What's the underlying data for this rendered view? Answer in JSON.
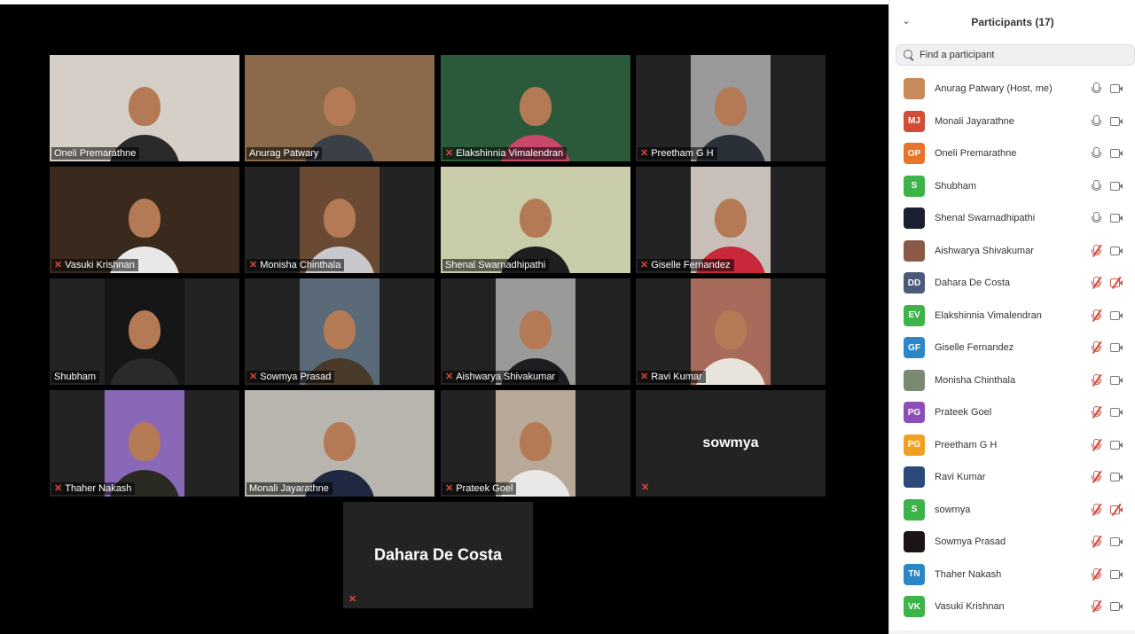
{
  "panel": {
    "title": "Participants (17)",
    "search_placeholder": "Find a participant",
    "participants": [
      {
        "name": "Anurag Patwary (Host, me)",
        "initials": "",
        "color": "#c98a5a",
        "mic": "on",
        "cam": "on"
      },
      {
        "name": "Monali Jayarathne",
        "initials": "MJ",
        "color": "#d24d36",
        "mic": "on",
        "cam": "on"
      },
      {
        "name": "Oneli Premarathne",
        "initials": "OP",
        "color": "#e8742a",
        "mic": "on",
        "cam": "on"
      },
      {
        "name": "Shubham",
        "initials": "S",
        "color": "#3db34a",
        "mic": "on",
        "cam": "on"
      },
      {
        "name": "Shenal Swarnadhipathi",
        "initials": "",
        "color": "#1b2030",
        "mic": "on",
        "cam": "on"
      },
      {
        "name": "Aishwarya Shivakumar",
        "initials": "",
        "color": "#8a5a46",
        "mic": "off",
        "cam": "on"
      },
      {
        "name": "Dahara De Costa",
        "initials": "DD",
        "color": "#4a5a78",
        "mic": "off",
        "cam": "off"
      },
      {
        "name": "Elakshinnia Vimalendran",
        "initials": "EV",
        "color": "#3db34a",
        "mic": "off",
        "cam": "on"
      },
      {
        "name": "Giselle Fernandez",
        "initials": "GF",
        "color": "#2b86c5",
        "mic": "off",
        "cam": "on"
      },
      {
        "name": "Monisha Chinthala",
        "initials": "",
        "color": "#7a8a70",
        "mic": "off",
        "cam": "on"
      },
      {
        "name": "Prateek Goel",
        "initials": "PG",
        "color": "#8b4fb6",
        "mic": "off",
        "cam": "on"
      },
      {
        "name": "Preetham G H",
        "initials": "PG",
        "color": "#f0a020",
        "mic": "off",
        "cam": "on"
      },
      {
        "name": "Ravi Kumar",
        "initials": "",
        "color": "#2a4a7a",
        "mic": "off",
        "cam": "on"
      },
      {
        "name": "sowmya",
        "initials": "S",
        "color": "#3db34a",
        "mic": "off",
        "cam": "off"
      },
      {
        "name": "Sowmya Prasad",
        "initials": "",
        "color": "#1c1414",
        "mic": "off",
        "cam": "on"
      },
      {
        "name": "Thaher Nakash",
        "initials": "TN",
        "color": "#2b86c5",
        "mic": "off",
        "cam": "on"
      },
      {
        "name": "Vasuki Krishnan",
        "initials": "VK",
        "color": "#3db34a",
        "mic": "off",
        "cam": "on"
      }
    ]
  },
  "gallery": {
    "tiles": [
      {
        "label": "Oneli Premarathne",
        "muted": false,
        "bg": "#d6cfc8",
        "shirt": "#2a2a2a"
      },
      {
        "label": "Anurag Patwary",
        "muted": false,
        "active": true,
        "bg": "#8a6a4a",
        "shirt": "#3a3f48"
      },
      {
        "label": "Elakshinnia Vimalendran",
        "muted": true,
        "bg": "#2a5a3a",
        "shirt": "#c8476a"
      },
      {
        "label": "Preetham G H",
        "muted": true,
        "bg": "#9a9a9a",
        "shirt": "#2a3038"
      },
      {
        "label": "Vasuki Krishnan",
        "muted": true,
        "bg": "#3a2a1e",
        "shirt": "#e8e8e8"
      },
      {
        "label": "Monisha Chinthala",
        "muted": true,
        "bg": "#6a4a32",
        "shirt": "#c8c8cc"
      },
      {
        "label": "Shenal Swarnadhipathi",
        "muted": false,
        "bg": "#c8cca8",
        "shirt": "#1e1e1e"
      },
      {
        "label": "Giselle Fernandez",
        "muted": true,
        "bg": "#c8c0b8",
        "shirt": "#c8283a"
      },
      {
        "label": "Shubham",
        "muted": false,
        "bg": "#161616",
        "shirt": "#2a2a2a"
      },
      {
        "label": "Sowmya Prasad",
        "muted": true,
        "bg": "#5a6a78",
        "shirt": "#4a3a2a"
      },
      {
        "label": "Aishwarya Shivakumar",
        "muted": true,
        "bg": "#9a9a98",
        "shirt": "#1e1e22"
      },
      {
        "label": "Ravi Kumar",
        "muted": true,
        "bg": "#a86a5a",
        "shirt": "#e8e4dc"
      },
      {
        "label": "Thaher Nakash",
        "muted": true,
        "bg": "#8a68b8",
        "shirt": "#2a2a22"
      },
      {
        "label": "Monali Jayarathne",
        "muted": false,
        "bg": "#b8b4ae",
        "shirt": "#1e2840"
      },
      {
        "label": "Prateek Goel",
        "muted": true,
        "bg": "#b8a898",
        "shirt": "#e8e8e8"
      },
      {
        "big_name": "sowmya",
        "muted": true
      },
      {
        "big_name": "Dahara De Costa",
        "muted": true
      }
    ]
  }
}
